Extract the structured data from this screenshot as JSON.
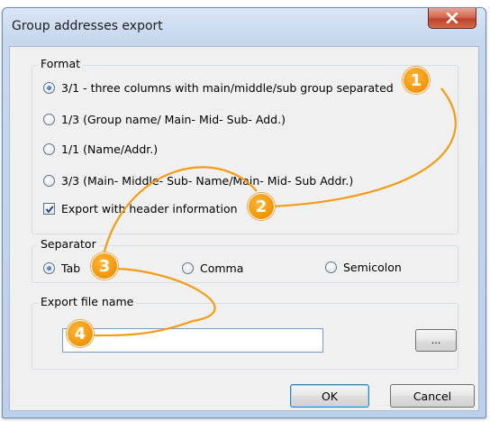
{
  "window": {
    "title": "Group addresses export",
    "close_icon": "close-x-icon"
  },
  "format": {
    "legend": "Format",
    "options": [
      {
        "label": "3/1 - three columns with main/middle/sub group separated",
        "selected": true
      },
      {
        "label": "1/3 (Group name/ Main-  Mid- Sub- Add.)",
        "selected": false
      },
      {
        "label": "1/1 (Name/Addr.)",
        "selected": false
      },
      {
        "label": "3/3 (Main- Middle- Sub- Name/Main- Mid- Sub Addr.)",
        "selected": false
      }
    ],
    "header_checkbox": {
      "label": "Export with header information",
      "checked": true
    }
  },
  "separator": {
    "legend": "Separator",
    "options": [
      {
        "label": "Tab",
        "selected": true
      },
      {
        "label": "Comma",
        "selected": false
      },
      {
        "label": "Semicolon",
        "selected": false
      }
    ]
  },
  "export_file": {
    "legend": "Export file name",
    "value": "",
    "browse_label": "..."
  },
  "buttons": {
    "ok": "OK",
    "cancel": "Cancel"
  },
  "callouts": {
    "color": "#f39c12",
    "badges": [
      "1",
      "2",
      "3",
      "4"
    ]
  }
}
